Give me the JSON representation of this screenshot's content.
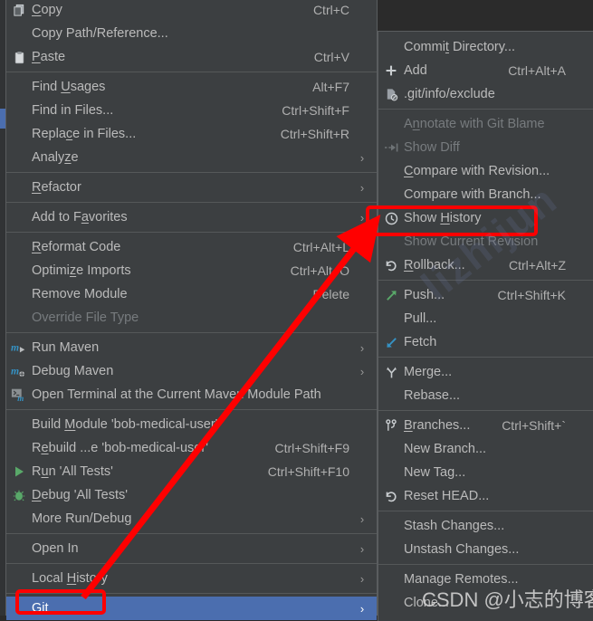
{
  "theme": {
    "menu_bg": "#3c3f41",
    "menu_border": "#5a5d5f",
    "text": "#bbbbbb",
    "text_disabled": "#777b7e",
    "highlight_bg": "#4b6eaf",
    "annotation_red": "#ff0000",
    "maven_blue": "#3592c4",
    "run_green": "#59a869"
  },
  "context_menu": {
    "name": "editor-context-menu",
    "groups": [
      {
        "items": [
          {
            "label": "Copy",
            "mnemonic": "C",
            "accel": "Ctrl+C",
            "icon": "copy-icon",
            "submenu": false,
            "disabled": false
          },
          {
            "label": "Copy Path/Reference...",
            "mnemonic": "",
            "accel": "",
            "icon": "",
            "submenu": false,
            "disabled": false
          },
          {
            "label": "Paste",
            "mnemonic": "P",
            "accel": "Ctrl+V",
            "icon": "paste-icon",
            "submenu": false,
            "disabled": false
          }
        ]
      },
      {
        "items": [
          {
            "label": "Find Usages",
            "mnemonic": "U",
            "accel": "Alt+F7",
            "icon": "",
            "submenu": false,
            "disabled": false
          },
          {
            "label": "Find in Files...",
            "mnemonic": "",
            "accel": "Ctrl+Shift+F",
            "icon": "",
            "submenu": false,
            "disabled": false
          },
          {
            "label": "Replace in Files...",
            "mnemonic": "c",
            "accel": "Ctrl+Shift+R",
            "icon": "",
            "submenu": false,
            "disabled": false
          },
          {
            "label": "Analyze",
            "mnemonic": "z",
            "accel": "",
            "icon": "",
            "submenu": true,
            "disabled": false
          }
        ]
      },
      {
        "items": [
          {
            "label": "Refactor",
            "mnemonic": "R",
            "accel": "",
            "icon": "",
            "submenu": true,
            "disabled": false
          }
        ]
      },
      {
        "items": [
          {
            "label": "Add to Favorites",
            "mnemonic": "a",
            "accel": "",
            "icon": "",
            "submenu": true,
            "disabled": false
          }
        ]
      },
      {
        "items": [
          {
            "label": "Reformat Code",
            "mnemonic": "R",
            "accel": "Ctrl+Alt+L",
            "icon": "",
            "submenu": false,
            "disabled": false
          },
          {
            "label": "Optimize Imports",
            "mnemonic": "z",
            "accel": "Ctrl+Alt+O",
            "icon": "",
            "submenu": false,
            "disabled": false
          },
          {
            "label": "Remove Module",
            "mnemonic": "",
            "accel": "Delete",
            "icon": "",
            "submenu": false,
            "disabled": false
          },
          {
            "label": "Override File Type",
            "mnemonic": "",
            "accel": "",
            "icon": "",
            "submenu": false,
            "disabled": true
          }
        ]
      },
      {
        "items": [
          {
            "label": "Run Maven",
            "mnemonic": "",
            "accel": "",
            "icon": "maven-run-icon",
            "submenu": true,
            "disabled": false
          },
          {
            "label": "Debug Maven",
            "mnemonic": "",
            "accel": "",
            "icon": "maven-debug-icon",
            "submenu": true,
            "disabled": false
          },
          {
            "label": "Open Terminal at the Current Maven Module Path",
            "mnemonic": "",
            "accel": "",
            "icon": "terminal-maven-icon",
            "submenu": false,
            "disabled": false
          }
        ]
      },
      {
        "items": [
          {
            "label": "Build Module 'bob-medical-user'",
            "mnemonic": "M",
            "accel": "",
            "icon": "",
            "submenu": false,
            "disabled": false
          },
          {
            "label": "Rebuild ...e 'bob-medical-user'",
            "mnemonic": "e",
            "accel": "Ctrl+Shift+F9",
            "icon": "",
            "submenu": false,
            "disabled": false
          },
          {
            "label": "Run 'All Tests'",
            "mnemonic": "u",
            "accel": "Ctrl+Shift+F10",
            "icon": "run-icon",
            "submenu": false,
            "disabled": false
          },
          {
            "label": "Debug 'All Tests'",
            "mnemonic": "D",
            "accel": "",
            "icon": "debug-icon",
            "submenu": false,
            "disabled": false
          },
          {
            "label": "More Run/Debug",
            "mnemonic": "",
            "accel": "",
            "icon": "",
            "submenu": true,
            "disabled": false
          }
        ]
      },
      {
        "items": [
          {
            "label": "Open In",
            "mnemonic": "",
            "accel": "",
            "icon": "",
            "submenu": true,
            "disabled": false
          }
        ]
      },
      {
        "items": [
          {
            "label": "Local History",
            "mnemonic": "H",
            "accel": "",
            "icon": "",
            "submenu": true,
            "disabled": false
          }
        ]
      },
      {
        "items": [
          {
            "label": "Git",
            "mnemonic": "G",
            "accel": "",
            "icon": "",
            "submenu": true,
            "disabled": false,
            "highlighted": true
          }
        ]
      }
    ]
  },
  "git_submenu": {
    "name": "git-submenu",
    "groups": [
      {
        "items": [
          {
            "label": "Commit Directory...",
            "mnemonic": "t",
            "accel": "",
            "icon": "",
            "submenu": false,
            "disabled": false
          },
          {
            "label": "Add",
            "mnemonic": "",
            "accel": "Ctrl+Alt+A",
            "icon": "plus-icon",
            "submenu": false,
            "disabled": false
          },
          {
            "label": ".git/info/exclude",
            "mnemonic": "",
            "accel": "",
            "icon": "exclude-file-icon",
            "submenu": false,
            "disabled": false
          }
        ]
      },
      {
        "items": [
          {
            "label": "Annotate with Git Blame",
            "mnemonic": "n",
            "accel": "",
            "icon": "",
            "submenu": false,
            "disabled": true
          },
          {
            "label": "Show Diff",
            "mnemonic": "",
            "accel": "",
            "icon": "diff-icon",
            "submenu": false,
            "disabled": true
          },
          {
            "label": "Compare with Revision...",
            "mnemonic": "C",
            "accel": "",
            "icon": "",
            "submenu": false,
            "disabled": false
          },
          {
            "label": "Compare with Branch...",
            "mnemonic": "",
            "accel": "",
            "icon": "",
            "submenu": false,
            "disabled": false
          },
          {
            "label": "Show History",
            "mnemonic": "H",
            "accel": "",
            "icon": "clock-icon",
            "submenu": false,
            "disabled": false,
            "annotated": true
          },
          {
            "label": "Show Current Revision",
            "mnemonic": "",
            "accel": "",
            "icon": "",
            "submenu": false,
            "disabled": true
          },
          {
            "label": "Rollback...",
            "mnemonic": "R",
            "accel": "Ctrl+Alt+Z",
            "icon": "rollback-icon",
            "submenu": false,
            "disabled": false
          }
        ]
      },
      {
        "items": [
          {
            "label": "Push...",
            "mnemonic": "",
            "accel": "Ctrl+Shift+K",
            "icon": "push-icon",
            "submenu": false,
            "disabled": false
          },
          {
            "label": "Pull...",
            "mnemonic": "",
            "accel": "",
            "icon": "",
            "submenu": false,
            "disabled": false
          },
          {
            "label": "Fetch",
            "mnemonic": "",
            "accel": "",
            "icon": "fetch-icon",
            "submenu": false,
            "disabled": false
          }
        ]
      },
      {
        "items": [
          {
            "label": "Merge...",
            "mnemonic": "",
            "accel": "",
            "icon": "merge-icon",
            "submenu": false,
            "disabled": false
          },
          {
            "label": "Rebase...",
            "mnemonic": "",
            "accel": "",
            "icon": "",
            "submenu": false,
            "disabled": false
          }
        ]
      },
      {
        "items": [
          {
            "label": "Branches...",
            "mnemonic": "B",
            "accel": "Ctrl+Shift+`",
            "icon": "branch-icon",
            "submenu": false,
            "disabled": false
          },
          {
            "label": "New Branch...",
            "mnemonic": "",
            "accel": "",
            "icon": "",
            "submenu": false,
            "disabled": false
          },
          {
            "label": "New Tag...",
            "mnemonic": "",
            "accel": "",
            "icon": "",
            "submenu": false,
            "disabled": false
          },
          {
            "label": "Reset HEAD...",
            "mnemonic": "",
            "accel": "",
            "icon": "rollback-icon",
            "submenu": false,
            "disabled": false
          }
        ]
      },
      {
        "items": [
          {
            "label": "Stash Changes...",
            "mnemonic": "",
            "accel": "",
            "icon": "",
            "submenu": false,
            "disabled": false
          },
          {
            "label": "Unstash Changes...",
            "mnemonic": "",
            "accel": "",
            "icon": "",
            "submenu": false,
            "disabled": false
          }
        ]
      },
      {
        "items": [
          {
            "label": "Manage Remotes...",
            "mnemonic": "",
            "accel": "",
            "icon": "",
            "submenu": false,
            "disabled": false
          },
          {
            "label": "Clone...",
            "mnemonic": "",
            "accel": "",
            "icon": "",
            "submenu": false,
            "disabled": false
          }
        ]
      }
    ]
  },
  "annotations": {
    "highlight_boxes": [
      {
        "name": "show-history-highlight",
        "target": "Show History"
      },
      {
        "name": "git-highlight",
        "target": "Git"
      }
    ],
    "arrow": {
      "name": "pointer-arrow",
      "from": "Git",
      "to": "Show History"
    }
  },
  "watermarks": {
    "diagonal": "lizhijun",
    "footer": "CSDN @小志的博客"
  }
}
